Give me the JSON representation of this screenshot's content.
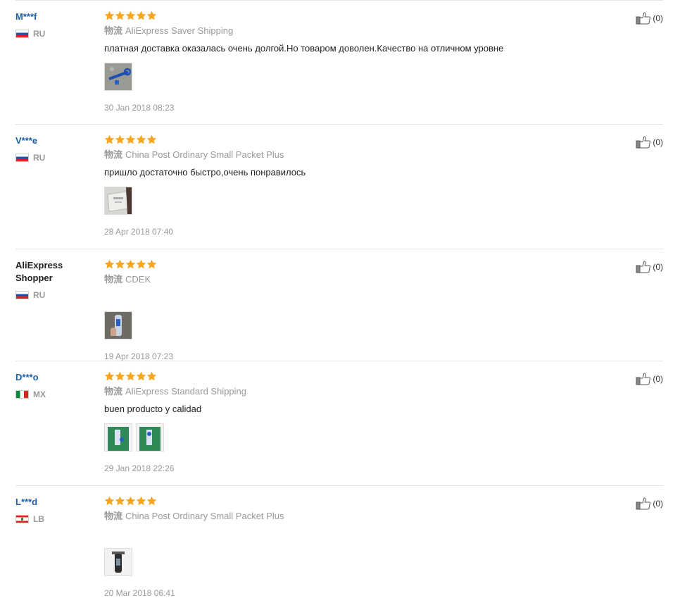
{
  "shipping_prefix": "物流",
  "reviews": [
    {
      "user": "M***f",
      "country": "RU",
      "flag": "ru",
      "shipping": "AliExpress Saver Shipping",
      "text": "платная доставка оказалась очень долгой.Но товаром доволен.Качество на отличном уровне",
      "photos": [
        "photo-blue-clip-on-concrete"
      ],
      "date": "30 Jan 2018 08:23",
      "helpful": "(0)",
      "rating": 5
    },
    {
      "user": "V***e",
      "country": "RU",
      "flag": "ru",
      "shipping": "China Post Ordinary Small Packet Plus",
      "text": "пришло достаточно быстро,очень понравилось",
      "photos": [
        "photo-package-bag"
      ],
      "date": "28 Apr 2018 07:40",
      "helpful": "(0)",
      "rating": 5
    },
    {
      "user": "AliExpress Shopper",
      "country": "RU",
      "flag": "ru",
      "shipping": "CDEK",
      "text": "",
      "photos": [
        "photo-bottle-in-hand"
      ],
      "date": "19 Apr 2018 07:23",
      "helpful": "(0)",
      "rating": 5
    },
    {
      "user": "D***o",
      "country": "MX",
      "flag": "mx",
      "shipping": "AliExpress Standard Shipping",
      "text": "buen producto y calidad",
      "photos": [
        "photo-green-bg-item-1",
        "photo-green-bg-item-2"
      ],
      "date": "29 Jan 2018 22:26",
      "helpful": "(0)",
      "rating": 5
    },
    {
      "user": "L***d",
      "country": "LB",
      "flag": "lb",
      "shipping": "China Post Ordinary Small Packet Plus",
      "text": "",
      "photos": [
        "photo-bottle-dark"
      ],
      "date": "20 Mar 2018 06:41",
      "helpful": "(0)",
      "rating": 5
    }
  ],
  "colors": {
    "star": "#f5a623",
    "user_link": "#1a5fa6",
    "muted": "#999999"
  }
}
